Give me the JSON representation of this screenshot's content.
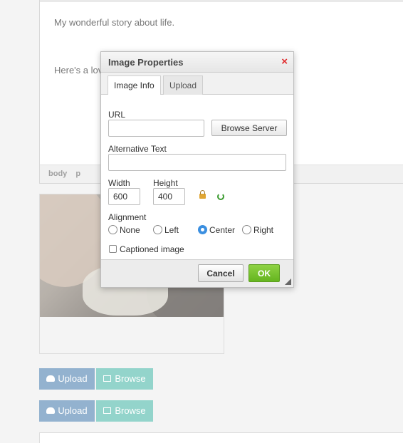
{
  "editor": {
    "line1": "My wonderful story about life.",
    "line2": "Here's a lov",
    "path": [
      "body",
      "p"
    ]
  },
  "buttons": {
    "row1": {
      "upload": "Upload",
      "browse": "Browse"
    },
    "row2": {
      "upload": "Upload",
      "browse": "Browse"
    }
  },
  "dialog": {
    "title": "Image Properties",
    "close_glyph": "×",
    "tabs": [
      "Image Info",
      "Upload"
    ],
    "active_tab": "Image Info",
    "url_label": "URL",
    "url_value": "",
    "browse_server": "Browse Server",
    "alt_label": "Alternative Text",
    "alt_value": "",
    "width_label": "Width",
    "width_value": "600",
    "height_label": "Height",
    "height_value": "400",
    "alignment_label": "Alignment",
    "alignment_options": [
      "None",
      "Left",
      "Center",
      "Right"
    ],
    "alignment_selected": "Center",
    "captioned_label": "Captioned image",
    "captioned_checked": false,
    "cancel": "Cancel",
    "ok": "OK"
  },
  "colors": {
    "accent_ok": "#65b51f",
    "close_red": "#e0282a",
    "upload_btn": "#93b2cf",
    "browse_btn": "#93d4cb"
  }
}
